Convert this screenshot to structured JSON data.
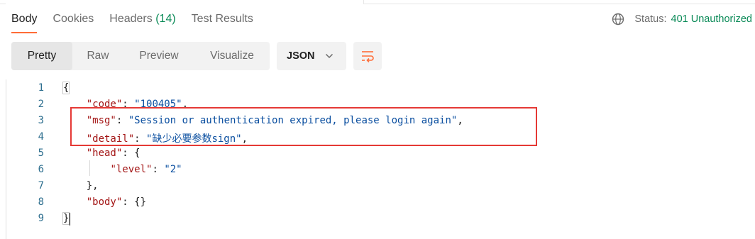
{
  "tabs": [
    {
      "label": "Body",
      "active": true
    },
    {
      "label": "Cookies"
    },
    {
      "label": "Headers",
      "count": "(14)"
    },
    {
      "label": "Test Results"
    }
  ],
  "status": {
    "label": "Status:",
    "code": "401 Unauthorized",
    "icon": "globe-icon",
    "color": "#0a8a57"
  },
  "view_modes": [
    {
      "label": "Pretty",
      "active": true
    },
    {
      "label": "Raw"
    },
    {
      "label": "Preview"
    },
    {
      "label": "Visualize"
    }
  ],
  "format": {
    "label": "JSON",
    "icon": "chevron-down-icon"
  },
  "wrap_button": {
    "icon": "wrap-lines-icon",
    "color": "#ff6c37"
  },
  "editor": {
    "line_numbers": [
      "1",
      "2",
      "3",
      "4",
      "5",
      "6",
      "7",
      "8",
      "9"
    ],
    "lines": {
      "l1": "{",
      "l2_key": "\"code\"",
      "l2_val": "\"100405\"",
      "l3_key": "\"msg\"",
      "l3_val": "\"Session or authentication expired, please login again\"",
      "l4_key": "\"detail\"",
      "l4_val": "\"缺少必要参数sign\"",
      "l5_key": "\"head\"",
      "l5_open": "{",
      "l6_key": "\"level\"",
      "l6_val": "\"2\"",
      "l7": "},",
      "l8_key": "\"body\"",
      "l8_val": "{}",
      "l9": "}"
    }
  },
  "annotation": {
    "color": "#e53935"
  }
}
